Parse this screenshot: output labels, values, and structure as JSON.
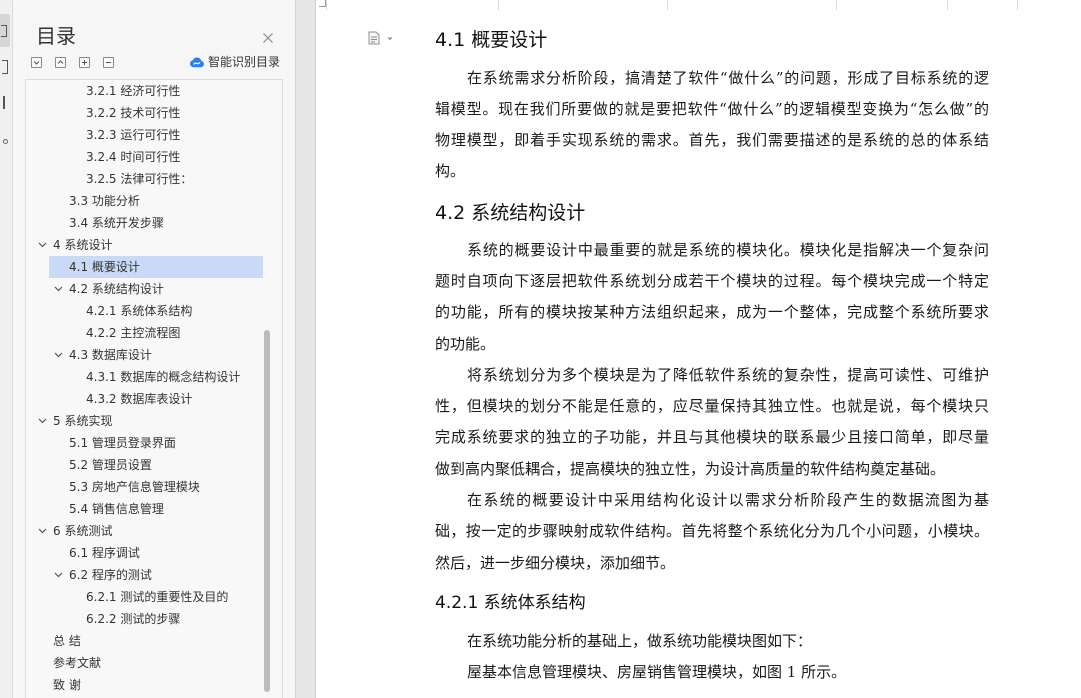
{
  "colors": {
    "selection": "#c9daf6",
    "accent": "#2f80ed",
    "text": "#1a1a1a"
  },
  "icons": {
    "nav_tab_active": "toc-tab-icon",
    "nav_tab_2": "bookmark-tab-icon",
    "nav_tab_3": "page-tab-icon",
    "nav_tab_4": "more-tab-icon",
    "close": "close-icon",
    "expand_all": "chevron-down-icon",
    "collapse_all": "chevron-up-icon",
    "promote": "plus-icon",
    "demote": "minus-icon",
    "smart_toc": "cloud-icon",
    "expanded_node": "chevron-down-icon",
    "doc_menu": "document-icon"
  },
  "toc": {
    "title": "目录",
    "smart_toc_label": "智能识别目录",
    "selected_index": 8,
    "items": [
      "3.2.1 经济可行性",
      "3.2.2 技术可行性",
      "3.2.3 运行可行性",
      "3.2.4 时间可行性",
      "3.2.5 法律可行性：",
      "3.3 功能分析",
      "3.4 系统开发步骤",
      "4 系统设计",
      "4.1 概要设计",
      "4.2 系统结构设计",
      "4.2.1 系统体系结构",
      "4.2.2 主控流程图",
      "4.3 数据库设计",
      "4.3.1 数据库的概念结构设计",
      "4.3.2 数据库表设计",
      "5 系统实现",
      "5.1 管理员登录界面",
      "5.2 管理员设置",
      "5.3 房地产信息管理模块",
      "5.4 销售信息管理",
      "6 系统测试",
      "6.1 程序调试",
      "6.2 程序的测试",
      "6.2.1 测试的重要性及目的",
      "6.2.2 测试的步骤",
      "总 结",
      "参考文献",
      "致 谢"
    ]
  },
  "document": {
    "heading_4_1": "4.1 概要设计",
    "p1": [
      "在系统需求分析阶段，搞清楚了软件“做什么”的问题，形成了目标系统的逻",
      "辑模型。现在我们所要做的就是要把软件“做什么”的逻辑模型变换为“怎么做”的",
      "物理模型，即着手实现系统的需求。首先，我们需要描述的是系统的总的体系结",
      "构。"
    ],
    "heading_4_2": "4.2 系统结构设计",
    "p2": [
      "系统的概要设计中最重要的就是系统的模块化。模块化是指解决一个复杂问",
      "题时自项向下逐层把软件系统划分成若干个模块的过程。每个模块完成一个特定",
      "的功能，所有的模块按某种方法组织起来，成为一个整体，完成整个系统所要求",
      "的功能。"
    ],
    "p3": [
      "将系统划分为多个模块是为了降低软件系统的复杂性，提高可读性、可维护",
      "性，但模块的划分不能是任意的，应尽量保持其独立性。也就是说，每个模块只",
      "完成系统要求的独立的子功能，并且与其他模块的联系最少且接口简单，即尽量",
      "做到高内聚低耦合，提高模块的独立性，为设计高质量的软件结构奠定基础。"
    ],
    "p4": [
      "在系统的概要设计中采用结构化设计以需求分析阶段产生的数据流图为基",
      "础，按一定的步骤映射成软件结构。首先将整个系统化分为几个小问题，小模块。",
      "然后，进一步细分模块，添加细节。"
    ],
    "heading_4_2_1": "4.2.1 系统体系结构",
    "p5": [
      "在系统功能分析的基础上，做系统功能模块图如下："
    ],
    "p6": [
      "屋基本信息管理模块、房屋销售管理模块，如图 1 所示。"
    ]
  }
}
